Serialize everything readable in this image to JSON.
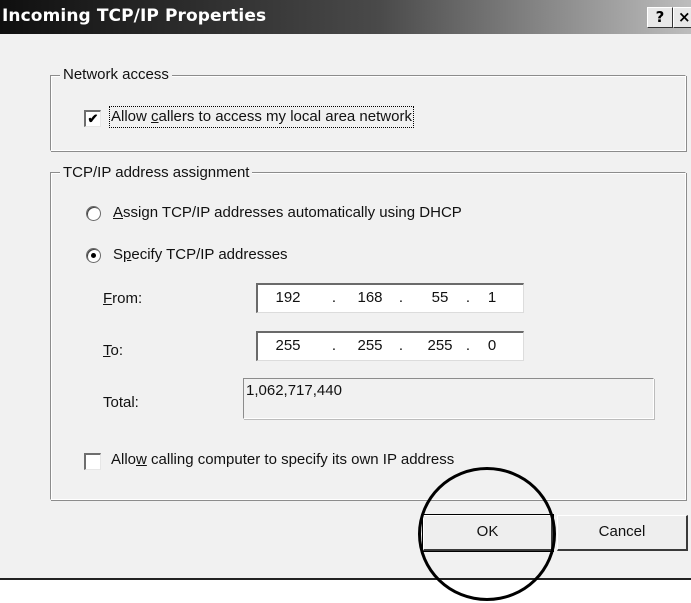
{
  "window": {
    "title": "Incoming TCP/IP Properties",
    "help_label": "?",
    "close_label": "×"
  },
  "network_access": {
    "legend": "Network access",
    "allow_lan": {
      "checked": true,
      "check_glyph": "✔",
      "label_pre": "Allow ",
      "label_accel": "c",
      "label_post": "allers to access my local area network"
    }
  },
  "tcpip": {
    "legend": "TCP/IP address assignment",
    "option_dhcp": {
      "selected": false,
      "label_accel": "A",
      "label_post": "ssign TCP/IP addresses automatically using DHCP"
    },
    "option_specify": {
      "selected": true,
      "label_pre": "S",
      "label_accel": "p",
      "label_post": "ecify TCP/IP addresses"
    },
    "from": {
      "label_accel": "F",
      "label_post": "rom:",
      "octets": [
        "192",
        "168",
        "55",
        "1"
      ]
    },
    "to": {
      "label_accel": "T",
      "label_post": "o:",
      "octets": [
        "255",
        "255",
        "255",
        "0"
      ]
    },
    "total": {
      "label": "Total:",
      "value": "1,062,717,440"
    },
    "allow_own_ip": {
      "checked": false,
      "label_pre": "Allo",
      "label_accel": "w",
      "label_post": " calling computer to specify its own IP address"
    }
  },
  "buttons": {
    "ok": "OK",
    "cancel": "Cancel"
  },
  "ip_separator": "."
}
